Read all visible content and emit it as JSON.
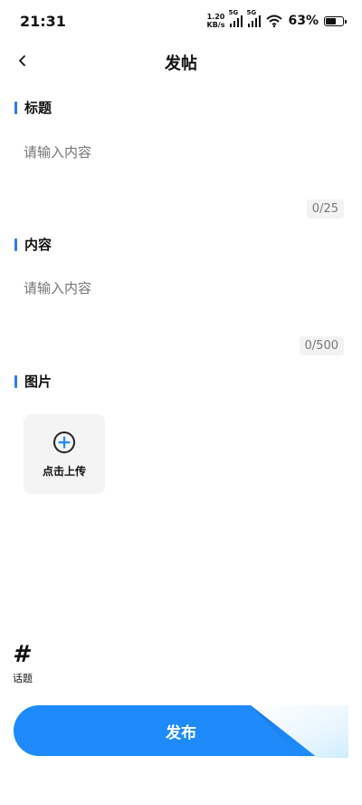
{
  "status_bar": {
    "time": "21:31",
    "net_speed_value": "1.20",
    "net_speed_unit": "KB/s",
    "signal1_label": "5G",
    "signal2_label": "5G",
    "battery_percent": "63%",
    "battery_level": 0.63
  },
  "header": {
    "title": "发帖",
    "back_icon": "chevron-left-icon"
  },
  "title_section": {
    "label": "标题",
    "placeholder": "请输入内容",
    "counter": "0/25"
  },
  "content_section": {
    "label": "内容",
    "placeholder": "请输入内容",
    "counter": "0/500"
  },
  "image_section": {
    "label": "图片",
    "upload_label": "点击上传",
    "upload_icon": "plus-circle-icon"
  },
  "topic": {
    "icon": "hashtag-icon",
    "label": "话题"
  },
  "publish": {
    "label": "发布"
  },
  "colors": {
    "accent": "#2a7cf7",
    "button": "#1f8bfa",
    "placeholder": "#c0c0c0"
  }
}
